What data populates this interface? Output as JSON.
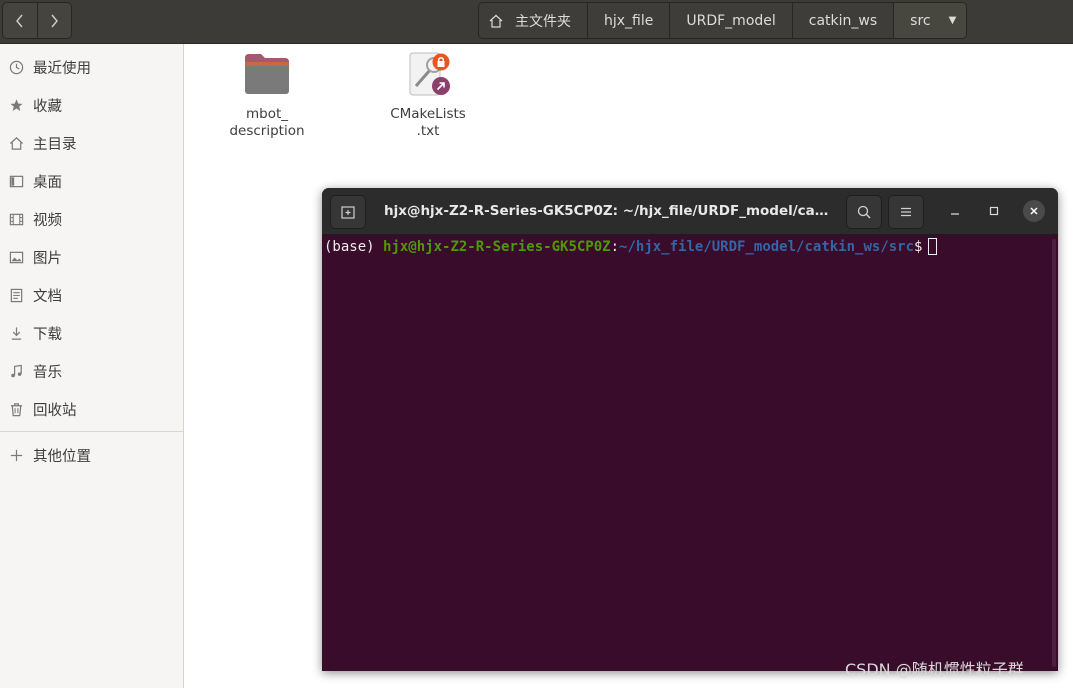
{
  "header": {
    "breadcrumbs": [
      {
        "label": "主文件夹",
        "icon": "home-icon"
      },
      {
        "label": "hjx_file"
      },
      {
        "label": "URDF_model"
      },
      {
        "label": "catkin_ws"
      },
      {
        "label": "src",
        "current": true
      }
    ]
  },
  "sidebar": {
    "items": [
      {
        "label": "最近使用",
        "icon": "clock-icon"
      },
      {
        "label": "收藏",
        "icon": "star-icon"
      },
      {
        "label": "主目录",
        "icon": "home-icon"
      },
      {
        "label": "桌面",
        "icon": "desktop-icon"
      },
      {
        "label": "视频",
        "icon": "video-icon"
      },
      {
        "label": "图片",
        "icon": "picture-icon"
      },
      {
        "label": "文档",
        "icon": "document-icon"
      },
      {
        "label": "下载",
        "icon": "download-icon"
      },
      {
        "label": "音乐",
        "icon": "music-icon"
      },
      {
        "label": "回收站",
        "icon": "trash-icon"
      },
      {
        "label": "其他位置",
        "icon": "plus-icon"
      }
    ]
  },
  "files": [
    {
      "line1": "mbot_",
      "line2": "description",
      "icon": "folder-icon"
    },
    {
      "line1": "CMakeLists",
      "line2": ".txt",
      "icon": "text-file-icon"
    }
  ],
  "terminal": {
    "title": "hjx@hjx-Z2-R-Series-GK5CP0Z: ~/hjx_file/URDF_model/catki...",
    "prompt_env": "(base) ",
    "prompt_user": "hjx@hjx-Z2-R-Series-GK5CP0Z",
    "prompt_colon": ":",
    "prompt_path": "~/hjx_file/URDF_model/catkin_ws/src",
    "prompt_symbol": "$"
  },
  "watermark": "CSDN @随机惯性粒子群",
  "colors": {
    "terminal_bg": "#380c2a",
    "prompt_user": "#4e9a06",
    "prompt_path": "#3465a4",
    "folder": "#a6586d"
  }
}
